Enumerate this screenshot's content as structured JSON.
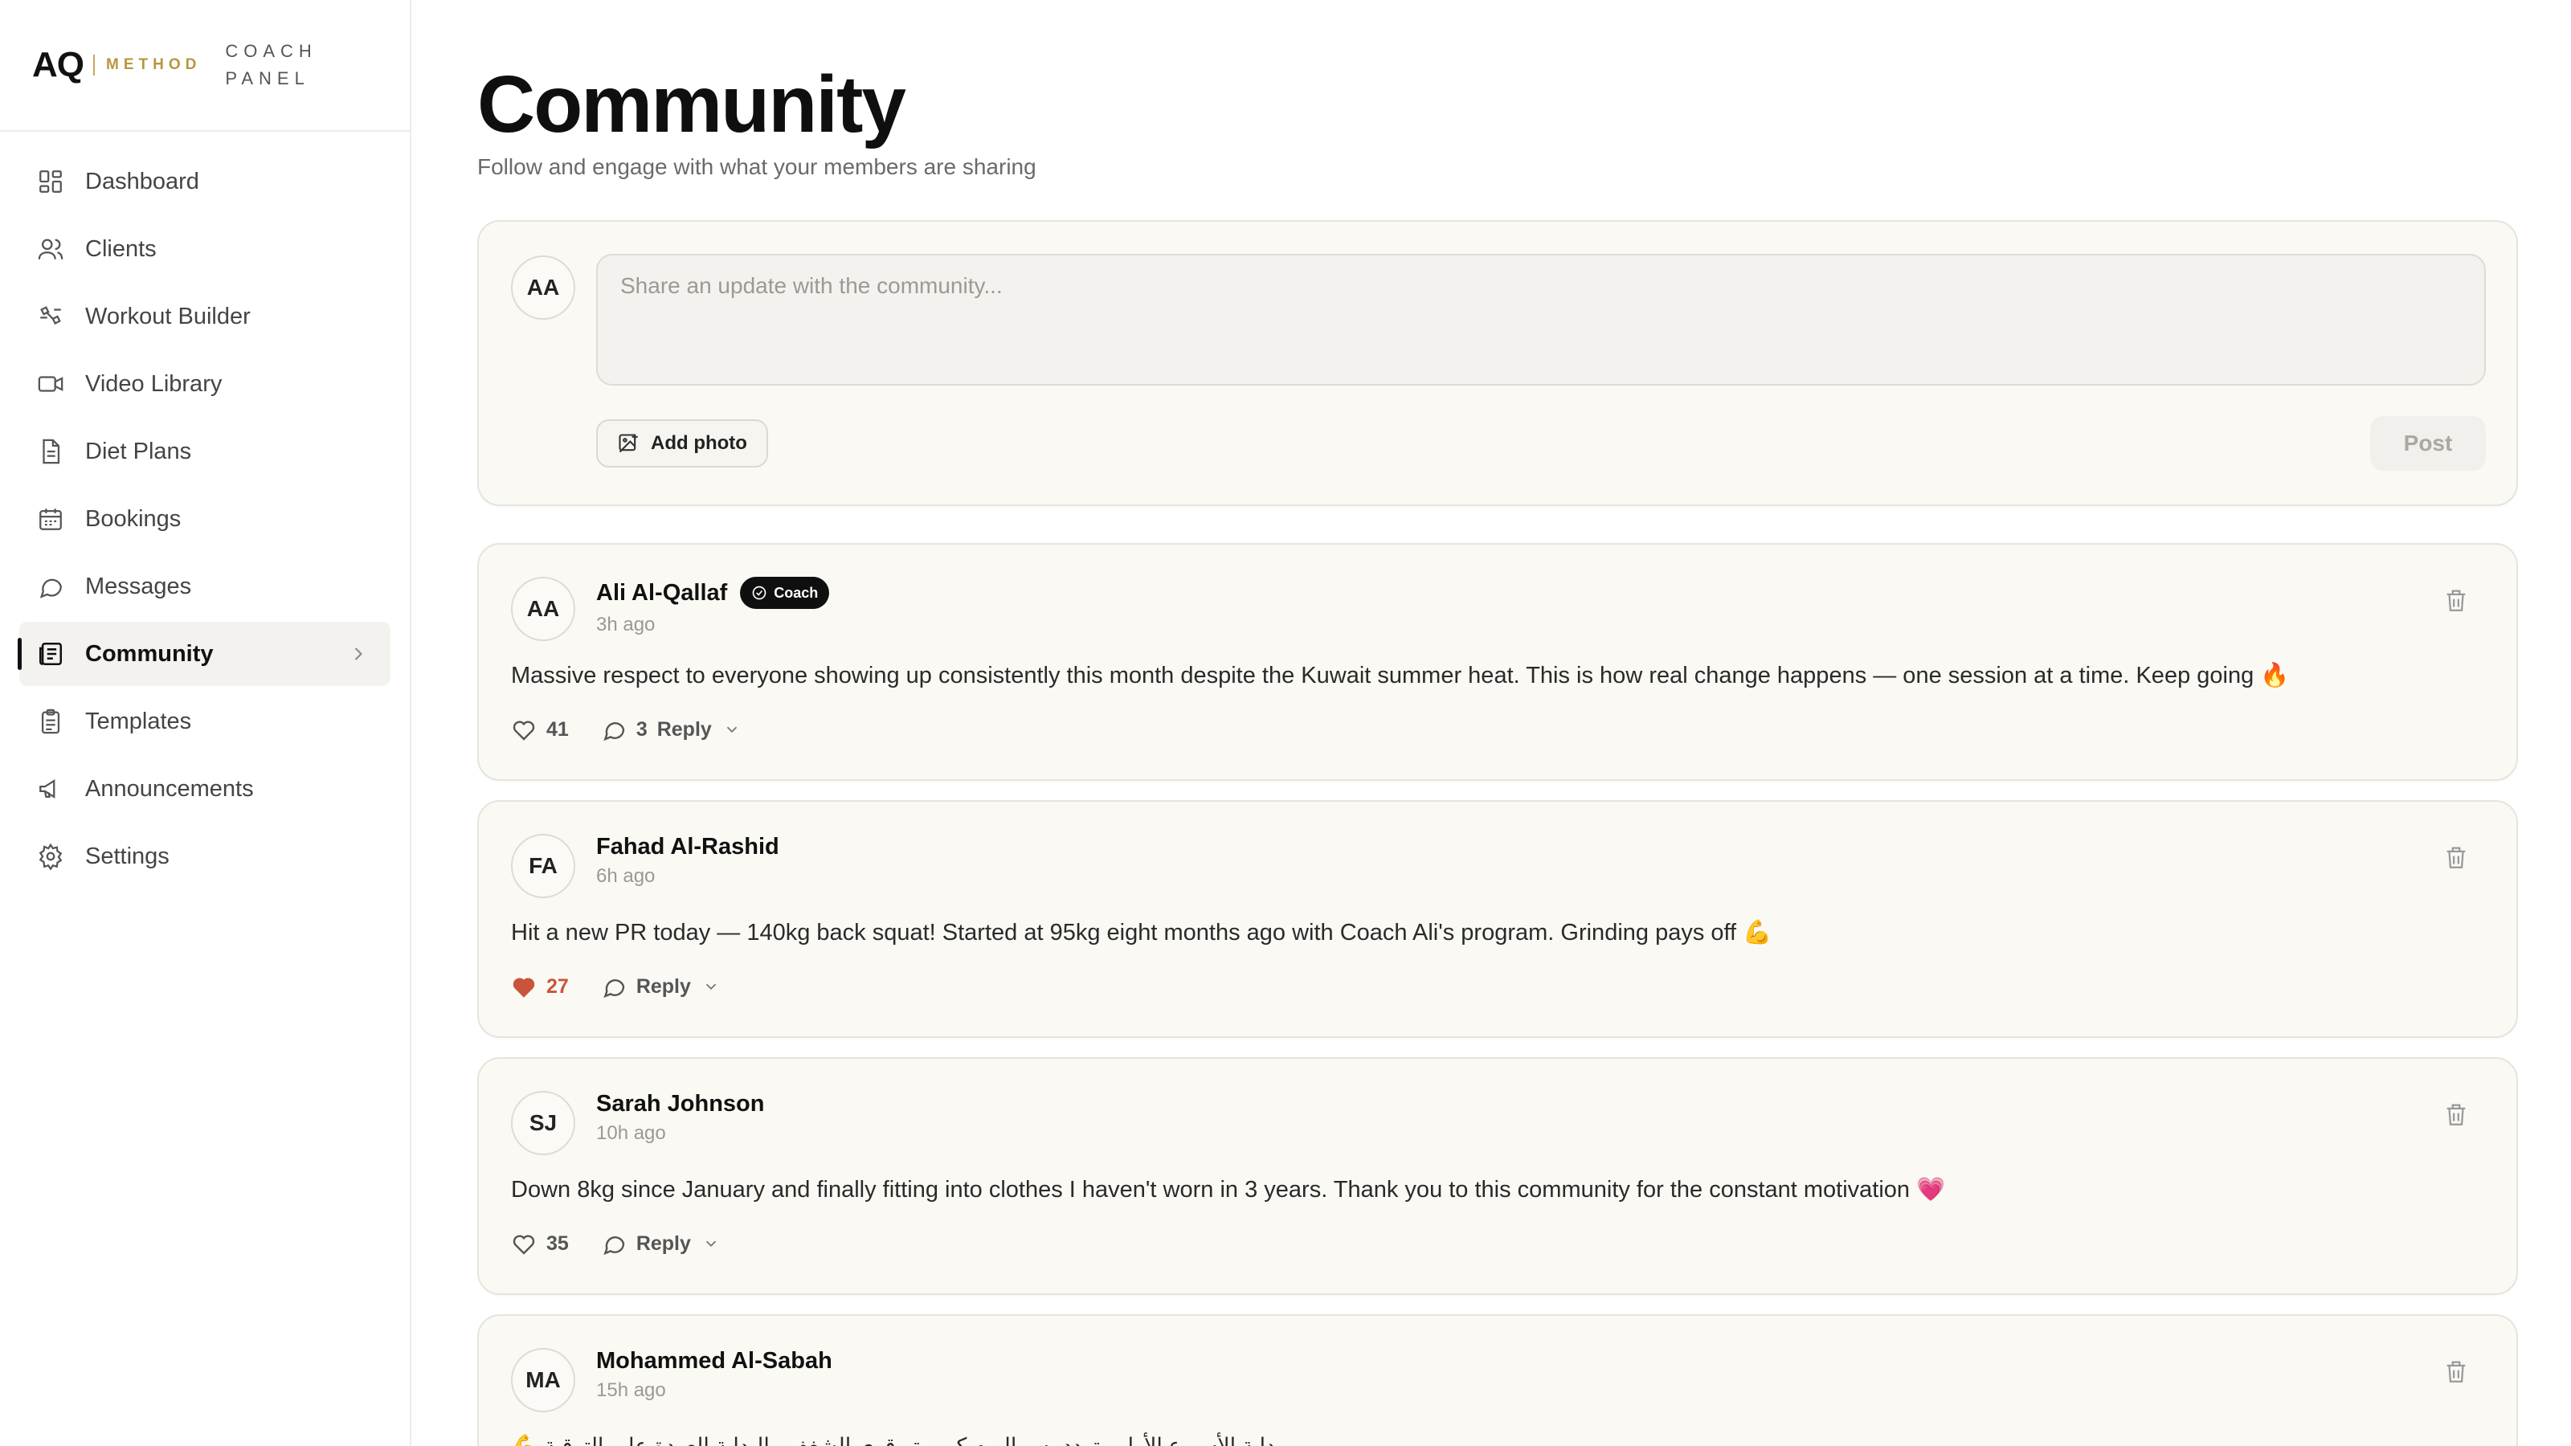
{
  "brand": {
    "logo": "AQ",
    "method": "METHOD",
    "panel_line1": "COACH",
    "panel_line2": "PANEL"
  },
  "nav": {
    "items": [
      {
        "label": "Dashboard",
        "icon": "dashboard-icon"
      },
      {
        "label": "Clients",
        "icon": "users-icon"
      },
      {
        "label": "Workout Builder",
        "icon": "workout-icon"
      },
      {
        "label": "Video Library",
        "icon": "video-icon"
      },
      {
        "label": "Diet Plans",
        "icon": "document-icon"
      },
      {
        "label": "Bookings",
        "icon": "calendar-icon"
      },
      {
        "label": "Messages",
        "icon": "message-icon"
      },
      {
        "label": "Community",
        "icon": "community-icon",
        "active": true
      },
      {
        "label": "Templates",
        "icon": "clipboard-icon"
      },
      {
        "label": "Announcements",
        "icon": "megaphone-icon"
      },
      {
        "label": "Settings",
        "icon": "gear-icon"
      }
    ]
  },
  "page": {
    "title": "Community",
    "subtitle": "Follow and engage with what your members are sharing"
  },
  "composer": {
    "avatar": "AA",
    "placeholder": "Share an update with the community...",
    "add_photo_label": "Add photo",
    "post_label": "Post"
  },
  "posts": [
    {
      "initials": "AA",
      "author": "Ali Al-Qallaf",
      "badge": "Coach",
      "time": "3h ago",
      "body": "Massive respect to everyone showing up consistently this month despite the Kuwait summer heat. This is how real change happens — one session at a time. Keep going 🔥",
      "likes": "41",
      "liked": false,
      "reply_count": "3",
      "reply_label": "Reply"
    },
    {
      "initials": "FA",
      "author": "Fahad Al-Rashid",
      "time": "6h ago",
      "body": "Hit a new PR today — 140kg back squat! Started at 95kg eight months ago with Coach Ali's program. Grinding pays off 💪",
      "likes": "27",
      "liked": true,
      "reply_label": "Reply"
    },
    {
      "initials": "SJ",
      "author": "Sarah Johnson",
      "time": "10h ago",
      "body": "Down 8kg since January and finally fitting into clothes I haven't worn in 3 years. Thank you to this community for the constant motivation 💗",
      "likes": "35",
      "liked": false,
      "reply_label": "Reply"
    },
    {
      "initials": "MA",
      "author": "Mohammed Al-Sabah",
      "time": "15h ago",
      "body": "بداية الأسبوع الأول متردد بس اليوم كمبيوتر قوي الشغف والبداية العودة على الترقية 💪"
    }
  ],
  "colors": {
    "accent": "#b8963f",
    "like_active": "#c8553a",
    "card_bg": "#faf9f4"
  }
}
